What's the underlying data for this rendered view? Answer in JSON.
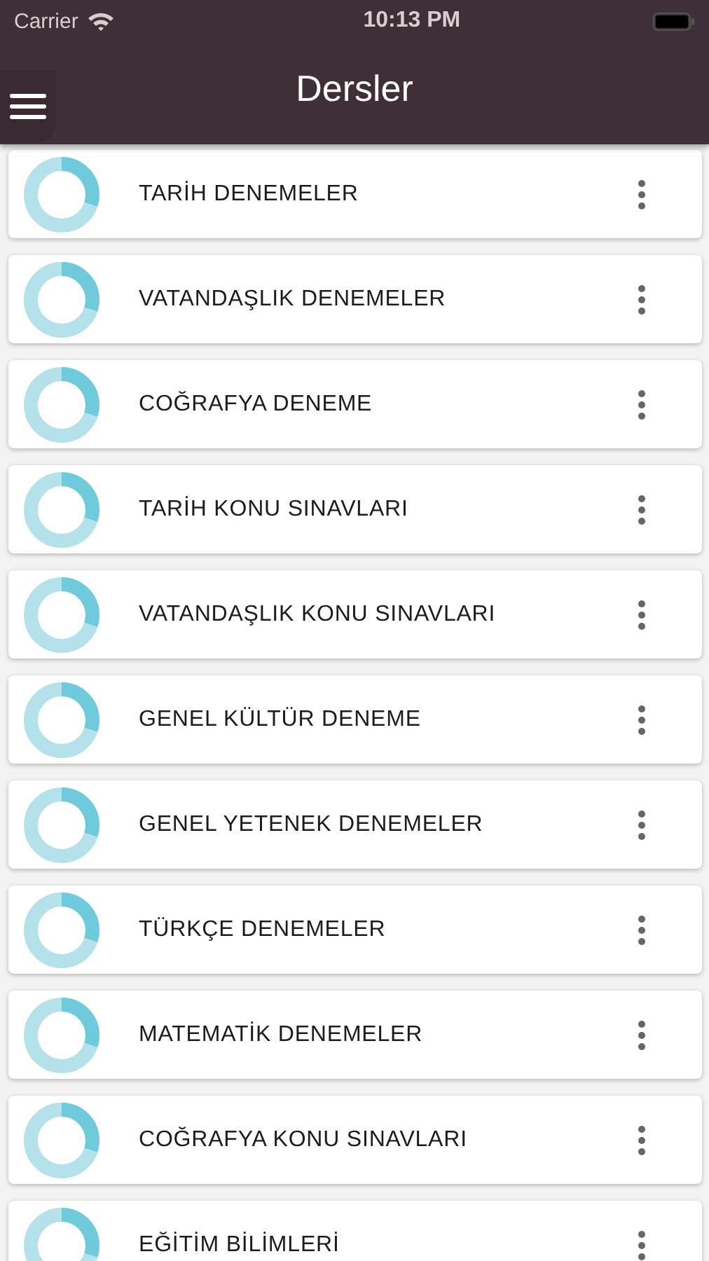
{
  "status_bar": {
    "carrier": "Carrier",
    "time": "10:13 PM"
  },
  "header": {
    "title": "Dersler"
  },
  "courses": [
    {
      "name": "TARİH DENEMELER",
      "level": 0.3
    },
    {
      "name": "VATANDAŞLIK DENEMELER",
      "level": 0.3
    },
    {
      "name": "COĞRAFYA DENEME",
      "level": 0.3
    },
    {
      "name": "TARİH KONU SINAVLARI",
      "level": 0.3
    },
    {
      "name": "VATANDAŞLIK KONU SINAVLARI",
      "level": 0.3
    },
    {
      "name": "GENEL KÜLTÜR DENEME",
      "level": 0.3
    },
    {
      "name": "GENEL YETENEK DENEMELER",
      "level": 0.3
    },
    {
      "name": "TÜRKÇE DENEMELER",
      "level": 0.3
    },
    {
      "name": "MATEMATİK DENEMELER",
      "level": 0.3
    },
    {
      "name": "COĞRAFYA KONU SINAVLARI",
      "level": 0.3
    },
    {
      "name": "EĞİTİM BİLİMLERİ",
      "level": 0.3
    }
  ]
}
